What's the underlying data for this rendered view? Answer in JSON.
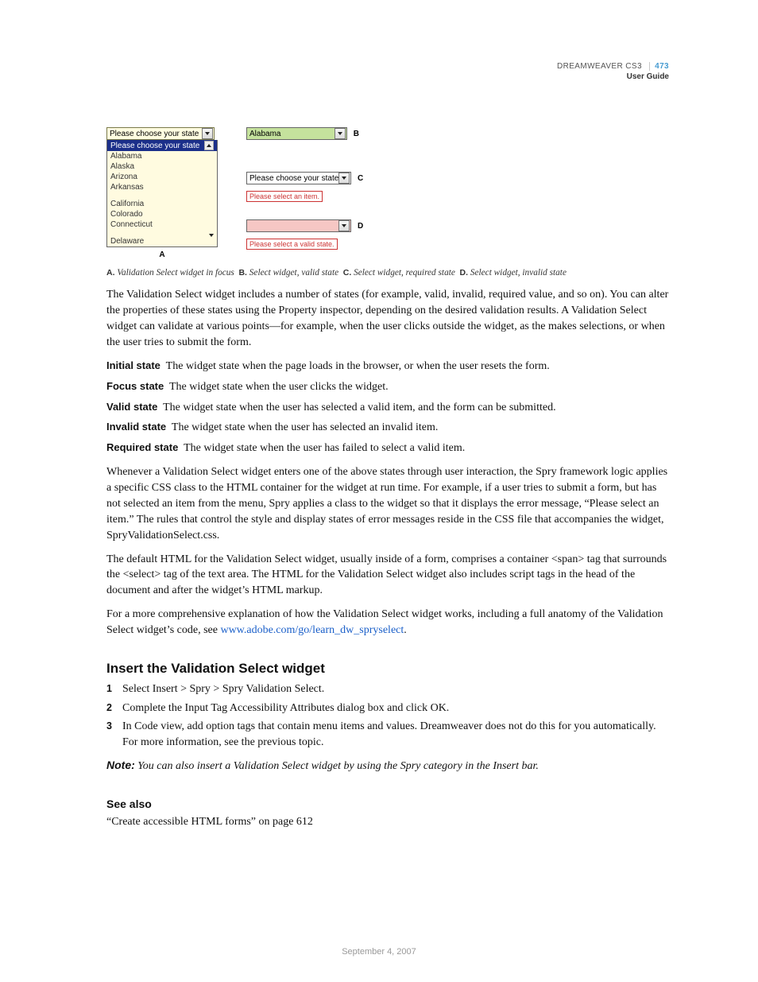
{
  "header": {
    "product": "DREAMWEAVER CS3",
    "guide": "User Guide",
    "page": "473"
  },
  "figure": {
    "a": {
      "placeholder": "Please choose your state",
      "selected": "Please choose your state",
      "options": [
        "Alabama",
        "Alaska",
        "Arizona",
        "Arkansas",
        "",
        "California",
        "Colorado",
        "Connecticut",
        "",
        "Delaware"
      ],
      "letter": "A"
    },
    "b": {
      "value": "Alabama",
      "letter": "B"
    },
    "c": {
      "value": "Please choose your state",
      "error": "Please select an item.",
      "letter": "C"
    },
    "d": {
      "value": "",
      "error": "Please select a valid state.",
      "letter": "D"
    }
  },
  "caption": {
    "A": {
      "label": "A.",
      "text": "Validation Select widget in focus"
    },
    "B": {
      "label": "B.",
      "text": "Select widget, valid state"
    },
    "C": {
      "label": "C.",
      "text": "Select widget, required state"
    },
    "D": {
      "label": "D.",
      "text": "Select widget, invalid state"
    }
  },
  "para1": "The Validation Select widget includes a number of states (for example, valid, invalid, required value, and so on). You can alter the properties of these states using the Property inspector, depending on the desired validation results. A Validation Select widget can validate at various points—for example, when the user clicks outside the widget, as the makes selections, or when the user tries to submit the form.",
  "defs": [
    {
      "term": "Initial state",
      "text": "The widget state when the page loads in the browser, or when the user resets the form."
    },
    {
      "term": "Focus state",
      "text": "The widget state when the user clicks the widget."
    },
    {
      "term": "Valid state",
      "text": "The widget state when the user has selected a valid item, and the form can be submitted."
    },
    {
      "term": "Invalid state",
      "text": "The widget state when the user has selected an invalid item."
    },
    {
      "term": "Required state",
      "text": "The widget state when the user has failed to select a valid item."
    }
  ],
  "para2": "Whenever a Validation Select widget enters one of the above states through user interaction, the Spry framework logic applies a specific CSS class to the HTML container for the widget at run time. For example, if a user tries to submit a form, but has not selected an item from the menu, Spry applies a class to the widget so that it displays the error message, “Please select an item.” The rules that control the style and display states of error messages reside in the CSS file that accompanies the widget, SpryValidationSelect.css.",
  "para3": "The default HTML for the Validation Select widget, usually inside of a form, comprises a container <span> tag that surrounds the <select> tag of the text area. The HTML for the Validation Select widget also includes script tags in the head of the document and after the widget’s HTML markup.",
  "para4_pre": "For a more comprehensive explanation of how the Validation Select widget works, including a full anatomy of the Validation Select widget’s code, see ",
  "para4_link": "www.adobe.com/go/learn_dw_spryselect",
  "para4_post": ".",
  "h2": "Insert the Validation Select widget",
  "steps": [
    "Select Insert > Spry > Spry Validation Select.",
    "Complete the Input Tag Accessibility Attributes dialog box and click OK.",
    "In Code view, add option tags that contain menu items and values. Dreamweaver does not do this for you automatically. For more information, see the previous topic."
  ],
  "note_label": "Note:",
  "note_text": "You can also insert a Validation Select widget by using the Spry category in the Insert bar.",
  "h3": "See also",
  "seealso": "“Create accessible HTML forms” on page 612",
  "footer": "September 4, 2007"
}
